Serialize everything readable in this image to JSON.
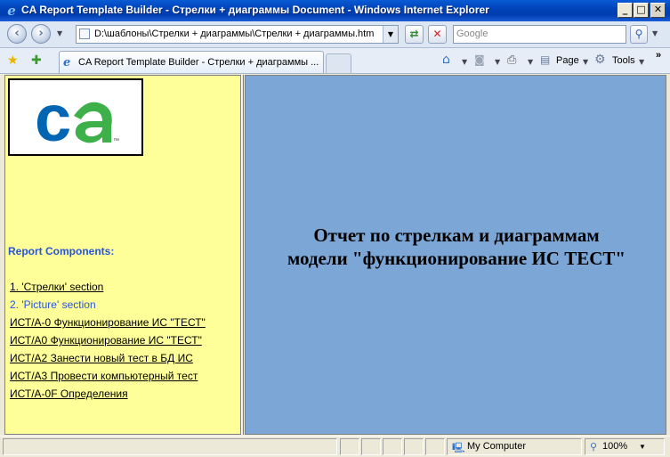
{
  "window": {
    "title": "CA Report Template Builder - Стрелки + диаграммы Document - Windows Internet Explorer",
    "minimize": "_",
    "maximize": "□",
    "close": "✕"
  },
  "navbar": {
    "address": "D:\\шаблоны\\Стрелки + диаграммы\\Стрелки + диаграммы.htm",
    "search_placeholder": "Google"
  },
  "tabs": [
    {
      "label": "CA Report Template Builder - Стрелки + диаграммы ..."
    }
  ],
  "commands": {
    "page": "Page",
    "tools": "Tools"
  },
  "left": {
    "logo_text": "ca",
    "logo_tm": "™",
    "components_title": "Report Components:",
    "links": [
      {
        "label": "1. 'Стрелки' section"
      },
      {
        "label": "2. 'Picture' section"
      },
      {
        "label": "ИСТ/A-0 Функционирование ИС \"ТЕСТ\""
      },
      {
        "label": "ИСТ/A0 Функционирование ИС \"ТЕСТ\""
      },
      {
        "label": "ИСТ/A2 Занести новый тест в БД ИС"
      },
      {
        "label": "ИСТ/A3 Провести компьютерный тест"
      },
      {
        "label": "ИСТ/A-0F Определения"
      }
    ]
  },
  "main": {
    "heading_line1": "Отчет по стрелкам и диаграммам",
    "heading_line2": "модели \"функционирование ИС ТЕСТ\""
  },
  "status": {
    "zone": "My Computer",
    "zoom": "100%"
  },
  "colors": {
    "left_bg": "#FFFF99",
    "right_bg": "#7BA6D6",
    "link_visited": "#2755D6",
    "ca_blue": "#0066B3",
    "ca_green": "#3EB049"
  }
}
